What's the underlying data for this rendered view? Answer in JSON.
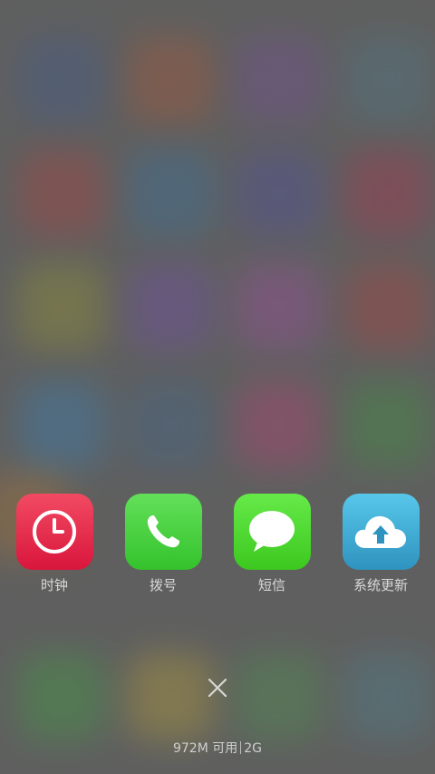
{
  "recent_apps": [
    {
      "label": "时钟",
      "icon": "clock-icon",
      "color_top": "#f24a63",
      "color_bottom": "#d9163c"
    },
    {
      "label": "拨号",
      "icon": "phone-icon",
      "color_top": "#63e05a",
      "color_bottom": "#34c22c"
    },
    {
      "label": "短信",
      "icon": "message-icon",
      "color_top": "#66ea49",
      "color_bottom": "#3cc81f"
    },
    {
      "label": "系统更新",
      "icon": "cloud-upload-icon",
      "color_top": "#57c7ea",
      "color_bottom": "#2f93bf"
    }
  ],
  "close_button": {
    "icon": "close-icon",
    "symbol": "✕"
  },
  "memory_status": {
    "available": "972M 可用",
    "network": "2G"
  },
  "colors": {
    "background": "#5f605f",
    "label_text": "#d9d9d9"
  }
}
